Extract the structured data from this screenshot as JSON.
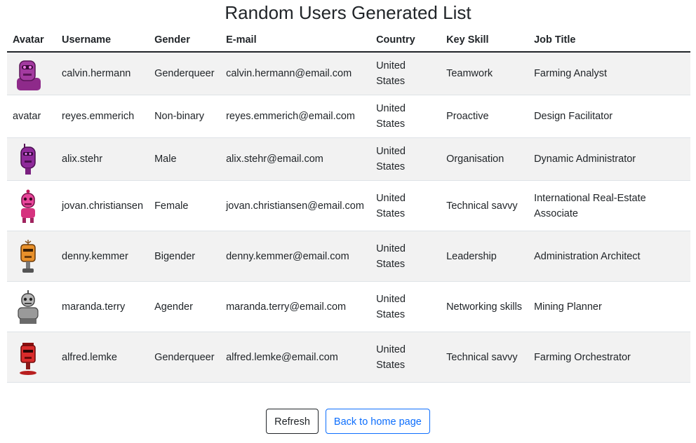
{
  "page": {
    "title": "Random Users Generated List"
  },
  "table": {
    "headers": [
      "Avatar",
      "Username",
      "Gender",
      "E-mail",
      "Country",
      "Key Skill",
      "Job Title"
    ],
    "rows": [
      {
        "avatar": "robot-avatar-purple",
        "username": "calvin.hermann",
        "gender": "Genderqueer",
        "email": "calvin.hermann@email.com",
        "country": "United States",
        "skill": "Teamwork",
        "job": "Farming Analyst"
      },
      {
        "avatar_alt": "avatar",
        "username": "reyes.emmerich",
        "gender": "Non-binary",
        "email": "reyes.emmerich@email.com",
        "country": "United States",
        "skill": "Proactive",
        "job": "Design Facilitator"
      },
      {
        "avatar": "robot-avatar-violet",
        "username": "alix.stehr",
        "gender": "Male",
        "email": "alix.stehr@email.com",
        "country": "United States",
        "skill": "Organisation",
        "job": "Dynamic Administrator"
      },
      {
        "avatar": "robot-avatar-pink",
        "username": "jovan.christiansen",
        "gender": "Female",
        "email": "jovan.christiansen@email.com",
        "country": "United States",
        "skill": "Technical savvy",
        "job": "International Real-Estate Associate"
      },
      {
        "avatar": "robot-avatar-orange",
        "username": "denny.kemmer",
        "gender": "Bigender",
        "email": "denny.kemmer@email.com",
        "country": "United States",
        "skill": "Leadership",
        "job": "Administration Architect"
      },
      {
        "avatar": "robot-avatar-gray",
        "username": "maranda.terry",
        "gender": "Agender",
        "email": "maranda.terry@email.com",
        "country": "United States",
        "skill": "Networking skills",
        "job": "Mining Planner"
      },
      {
        "avatar": "robot-avatar-red",
        "username": "alfred.lemke",
        "gender": "Genderqueer",
        "email": "alfred.lemke@email.com",
        "country": "United States",
        "skill": "Technical savvy",
        "job": "Farming Orchestrator"
      }
    ]
  },
  "buttons": {
    "refresh": "Refresh",
    "back": "Back to home page"
  },
  "colors": {
    "stripe": "#f2f2f2",
    "link_blue": "#0d6efd",
    "text": "#212529"
  }
}
